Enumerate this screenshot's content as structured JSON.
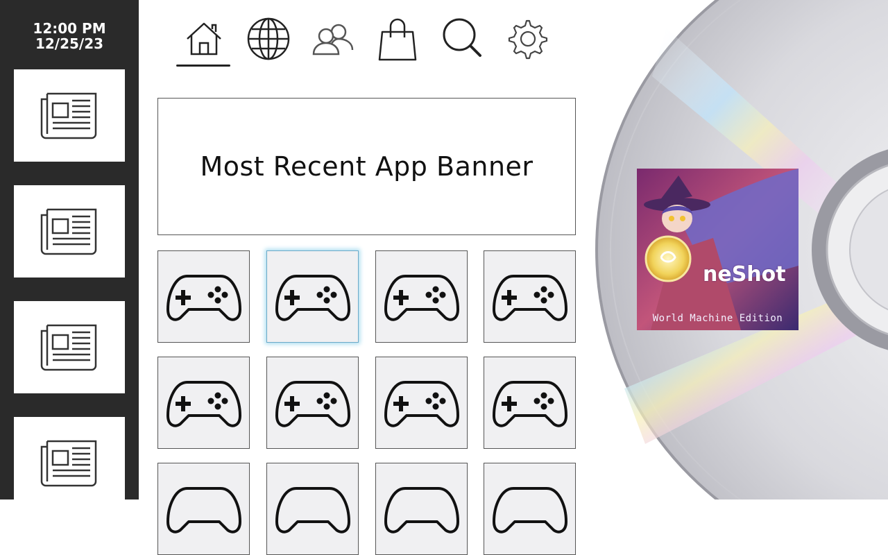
{
  "sidebar": {
    "time": "12:00 PM",
    "date": "12/25/23",
    "news_items": [
      {
        "icon": "newspaper-icon"
      },
      {
        "icon": "newspaper-icon"
      },
      {
        "icon": "newspaper-icon"
      },
      {
        "icon": "newspaper-icon"
      }
    ]
  },
  "nav": {
    "items": [
      {
        "icon": "home-icon",
        "selected": true
      },
      {
        "icon": "globe-icon",
        "selected": false
      },
      {
        "icon": "friends-icon",
        "selected": false
      },
      {
        "icon": "shopping-bag-icon",
        "selected": false
      },
      {
        "icon": "search-icon",
        "selected": false
      },
      {
        "icon": "gear-icon",
        "selected": false
      }
    ]
  },
  "banner": {
    "text": "Most Recent App Banner"
  },
  "app_grid": {
    "icon": "gamepad-icon",
    "selected_index": 1,
    "tile_count": 12
  },
  "featured": {
    "title": "neShot",
    "subtitle": "World Machine Edition",
    "accent_color": "#d9b84a"
  },
  "colors": {
    "sidebar_bg": "#2a2a2a",
    "tile_bg": "#f0f0f2",
    "selection_glow": "#a9dcef"
  }
}
